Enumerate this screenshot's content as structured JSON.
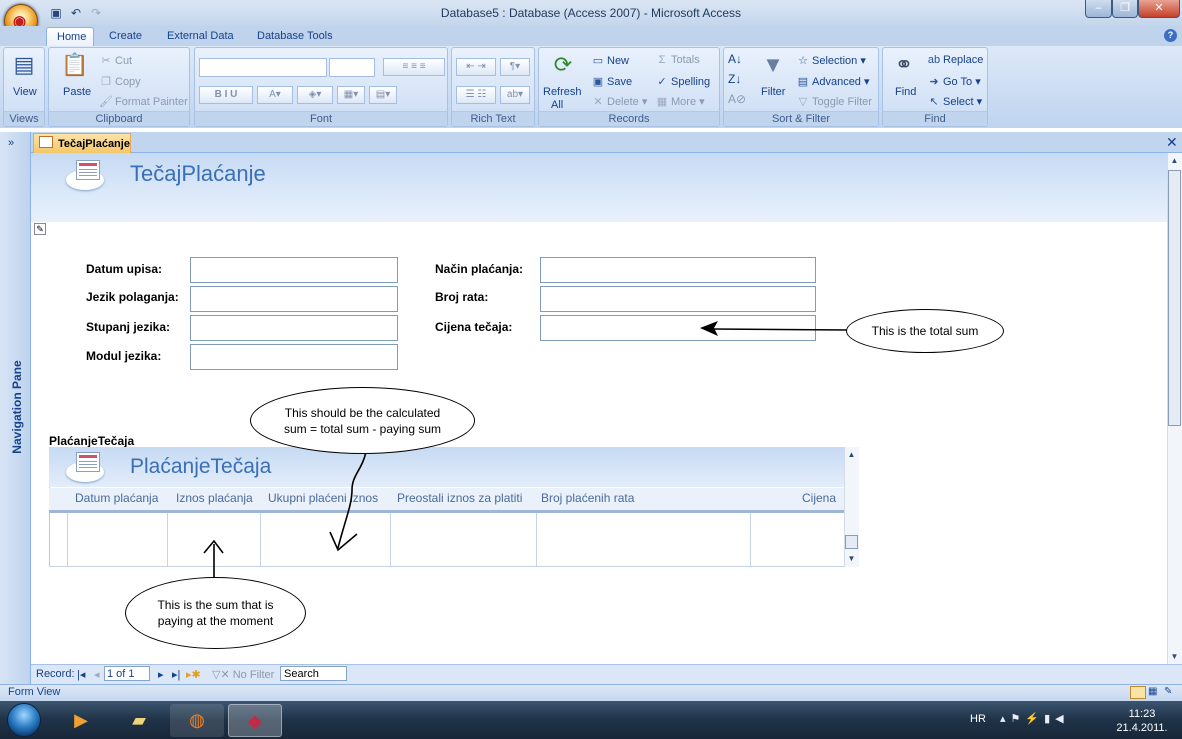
{
  "window": {
    "title": "Database5 : Database (Access 2007) - Microsoft Access",
    "controls": [
      "–",
      "❐",
      "✕"
    ]
  },
  "ribbon_tabs": [
    {
      "label": "Home",
      "active": true
    },
    {
      "label": "Create",
      "active": false
    },
    {
      "label": "External Data",
      "active": false
    },
    {
      "label": "Database Tools",
      "active": false
    }
  ],
  "ribbon": {
    "views": {
      "label": "Views",
      "view": "View"
    },
    "clipboard": {
      "label": "Clipboard",
      "paste": "Paste",
      "cut": "Cut",
      "copy": "Copy",
      "format_painter": "Format Painter"
    },
    "font": {
      "label": "Font"
    },
    "rich_text": {
      "label": "Rich Text"
    },
    "records": {
      "label": "Records",
      "refresh": "Refresh",
      "refresh_sub": "All",
      "new": "New",
      "save": "Save",
      "delete": "Delete",
      "totals": "Totals",
      "spelling": "Spelling",
      "more": "More"
    },
    "sort_filter": {
      "label": "Sort & Filter",
      "filter": "Filter",
      "selection": "Selection",
      "advanced": "Advanced",
      "toggle_filter": "Toggle Filter"
    },
    "find": {
      "label": "Find",
      "find": "Find",
      "replace": "Replace",
      "go_to": "Go To",
      "select": "Select"
    }
  },
  "nav_pane": {
    "label": "Navigation Pane",
    "toggle": "»"
  },
  "document_tab": {
    "label": "TečajPlaćanje",
    "close": "✕"
  },
  "form": {
    "title": "TečajPlaćanje",
    "fields_left": [
      "Datum upisa:",
      "Jezik polaganja:",
      "Stupanj jezika:",
      "Modul jezika:"
    ],
    "fields_right": [
      "Način plaćanja:",
      "Broj rata:",
      "Cijena tečaja:"
    ]
  },
  "subform": {
    "caption": "PlaćanjeTečaja",
    "title": "PlaćanjeTečaja",
    "columns": [
      "Datum plaćanja",
      "Iznos plaćanja",
      "Ukupni plaćeni iznos",
      "Preostali iznos za platiti",
      "Broj plaćenih rata",
      "Cijena"
    ]
  },
  "annotations": {
    "total_sum": "This is the total sum",
    "calculated_sum": "This should be the calculated sum = total sum - paying sum",
    "paying_sum": "This is the sum that is paying at the moment"
  },
  "record_nav": {
    "label": "Record:",
    "position": "1 of 1",
    "filter": "No Filter",
    "search": "Search"
  },
  "status": {
    "text": "Form View"
  },
  "taskbar": {
    "language": "HR",
    "time": "11:23",
    "date": "21.4.2011."
  }
}
